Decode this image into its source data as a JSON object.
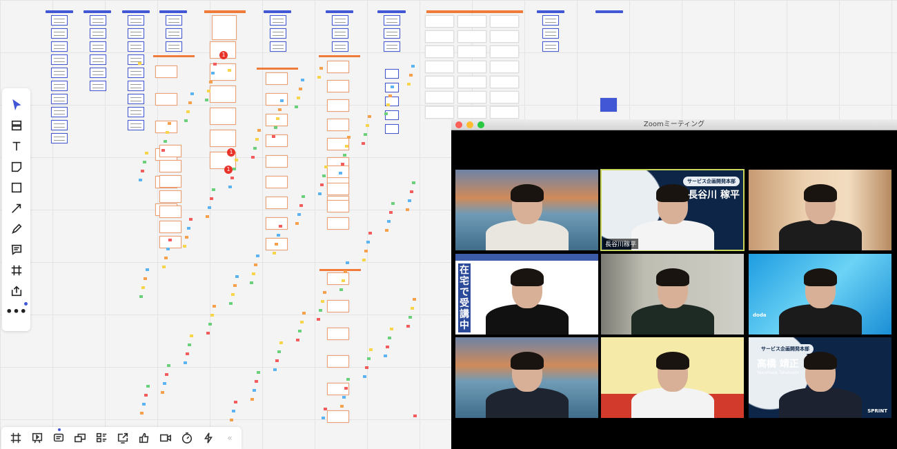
{
  "zoom_window": {
    "title": "Zoomミーティング",
    "participants": [
      {
        "background": "golden-gate"
      },
      {
        "background": "company-navy",
        "name_label": "長谷川稼平",
        "banner": "サービス企画開発本部",
        "display_name": "長谷川 稼平",
        "active_speaker": true
      },
      {
        "background": "living-room"
      },
      {
        "background": "classroom",
        "side_text": "在宅で受講中"
      },
      {
        "background": "white-wall"
      },
      {
        "background": "dodo-blue",
        "logo": "doda"
      },
      {
        "background": "golden-gate"
      },
      {
        "background": "cafe"
      },
      {
        "background": "company-navy",
        "banner": "サービス企画開発本部",
        "display_name": "高橋 靖正",
        "romaji": "Yasumasa Takahashi",
        "logo": "SPRINT"
      }
    ]
  },
  "board": {
    "notification_badges": [
      "1",
      "1",
      "1"
    ]
  },
  "left_toolbar": [
    "select",
    "templates",
    "text",
    "sticky-note",
    "shape",
    "connection-line",
    "pen",
    "comment",
    "frame",
    "upload",
    "more"
  ],
  "bottom_toolbar": [
    "frames",
    "presentation",
    "comments",
    "screen-share",
    "card-list",
    "export",
    "voting",
    "video-chat",
    "timer",
    "activity",
    "collapse"
  ],
  "colors": {
    "accent": "#4257d6",
    "orange": "#f07a3a",
    "active_speaker": "#c9d65a"
  }
}
